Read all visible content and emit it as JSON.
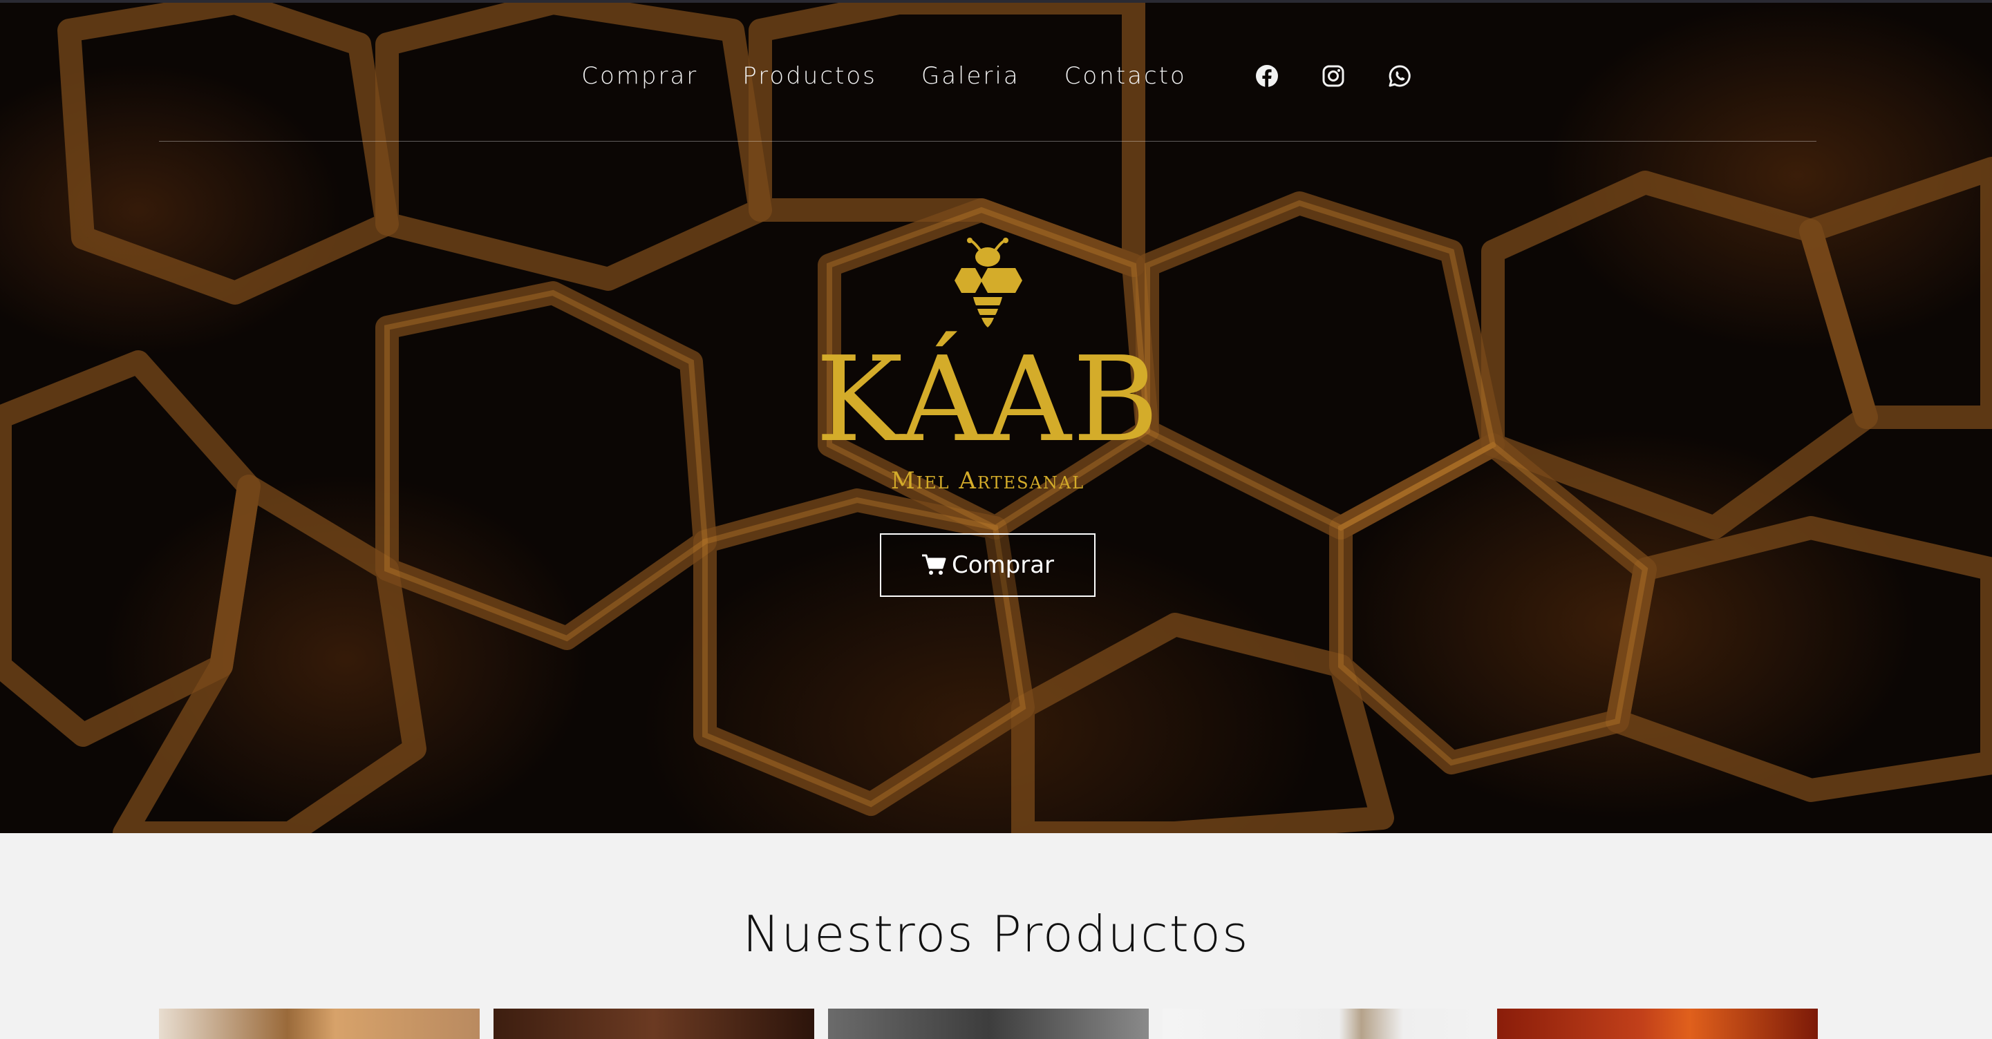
{
  "nav": {
    "links": [
      "Comprar",
      "Productos",
      "Galeria",
      "Contacto"
    ],
    "icons": [
      "facebook-icon",
      "instagram-icon",
      "whatsapp-icon"
    ]
  },
  "hero": {
    "brand": "KÁAB",
    "tagline": "Miel Artesanal",
    "cta_label": "Comprar",
    "cta_icon": "cart-icon"
  },
  "products": {
    "title": "Nuestros Productos",
    "items": [
      "product-1",
      "product-2",
      "product-3",
      "product-4",
      "product-5"
    ]
  },
  "colors": {
    "brand_gold": "#d4ac2a",
    "hero_dark": "#0b0604",
    "section_bg": "#f2f2f2"
  }
}
